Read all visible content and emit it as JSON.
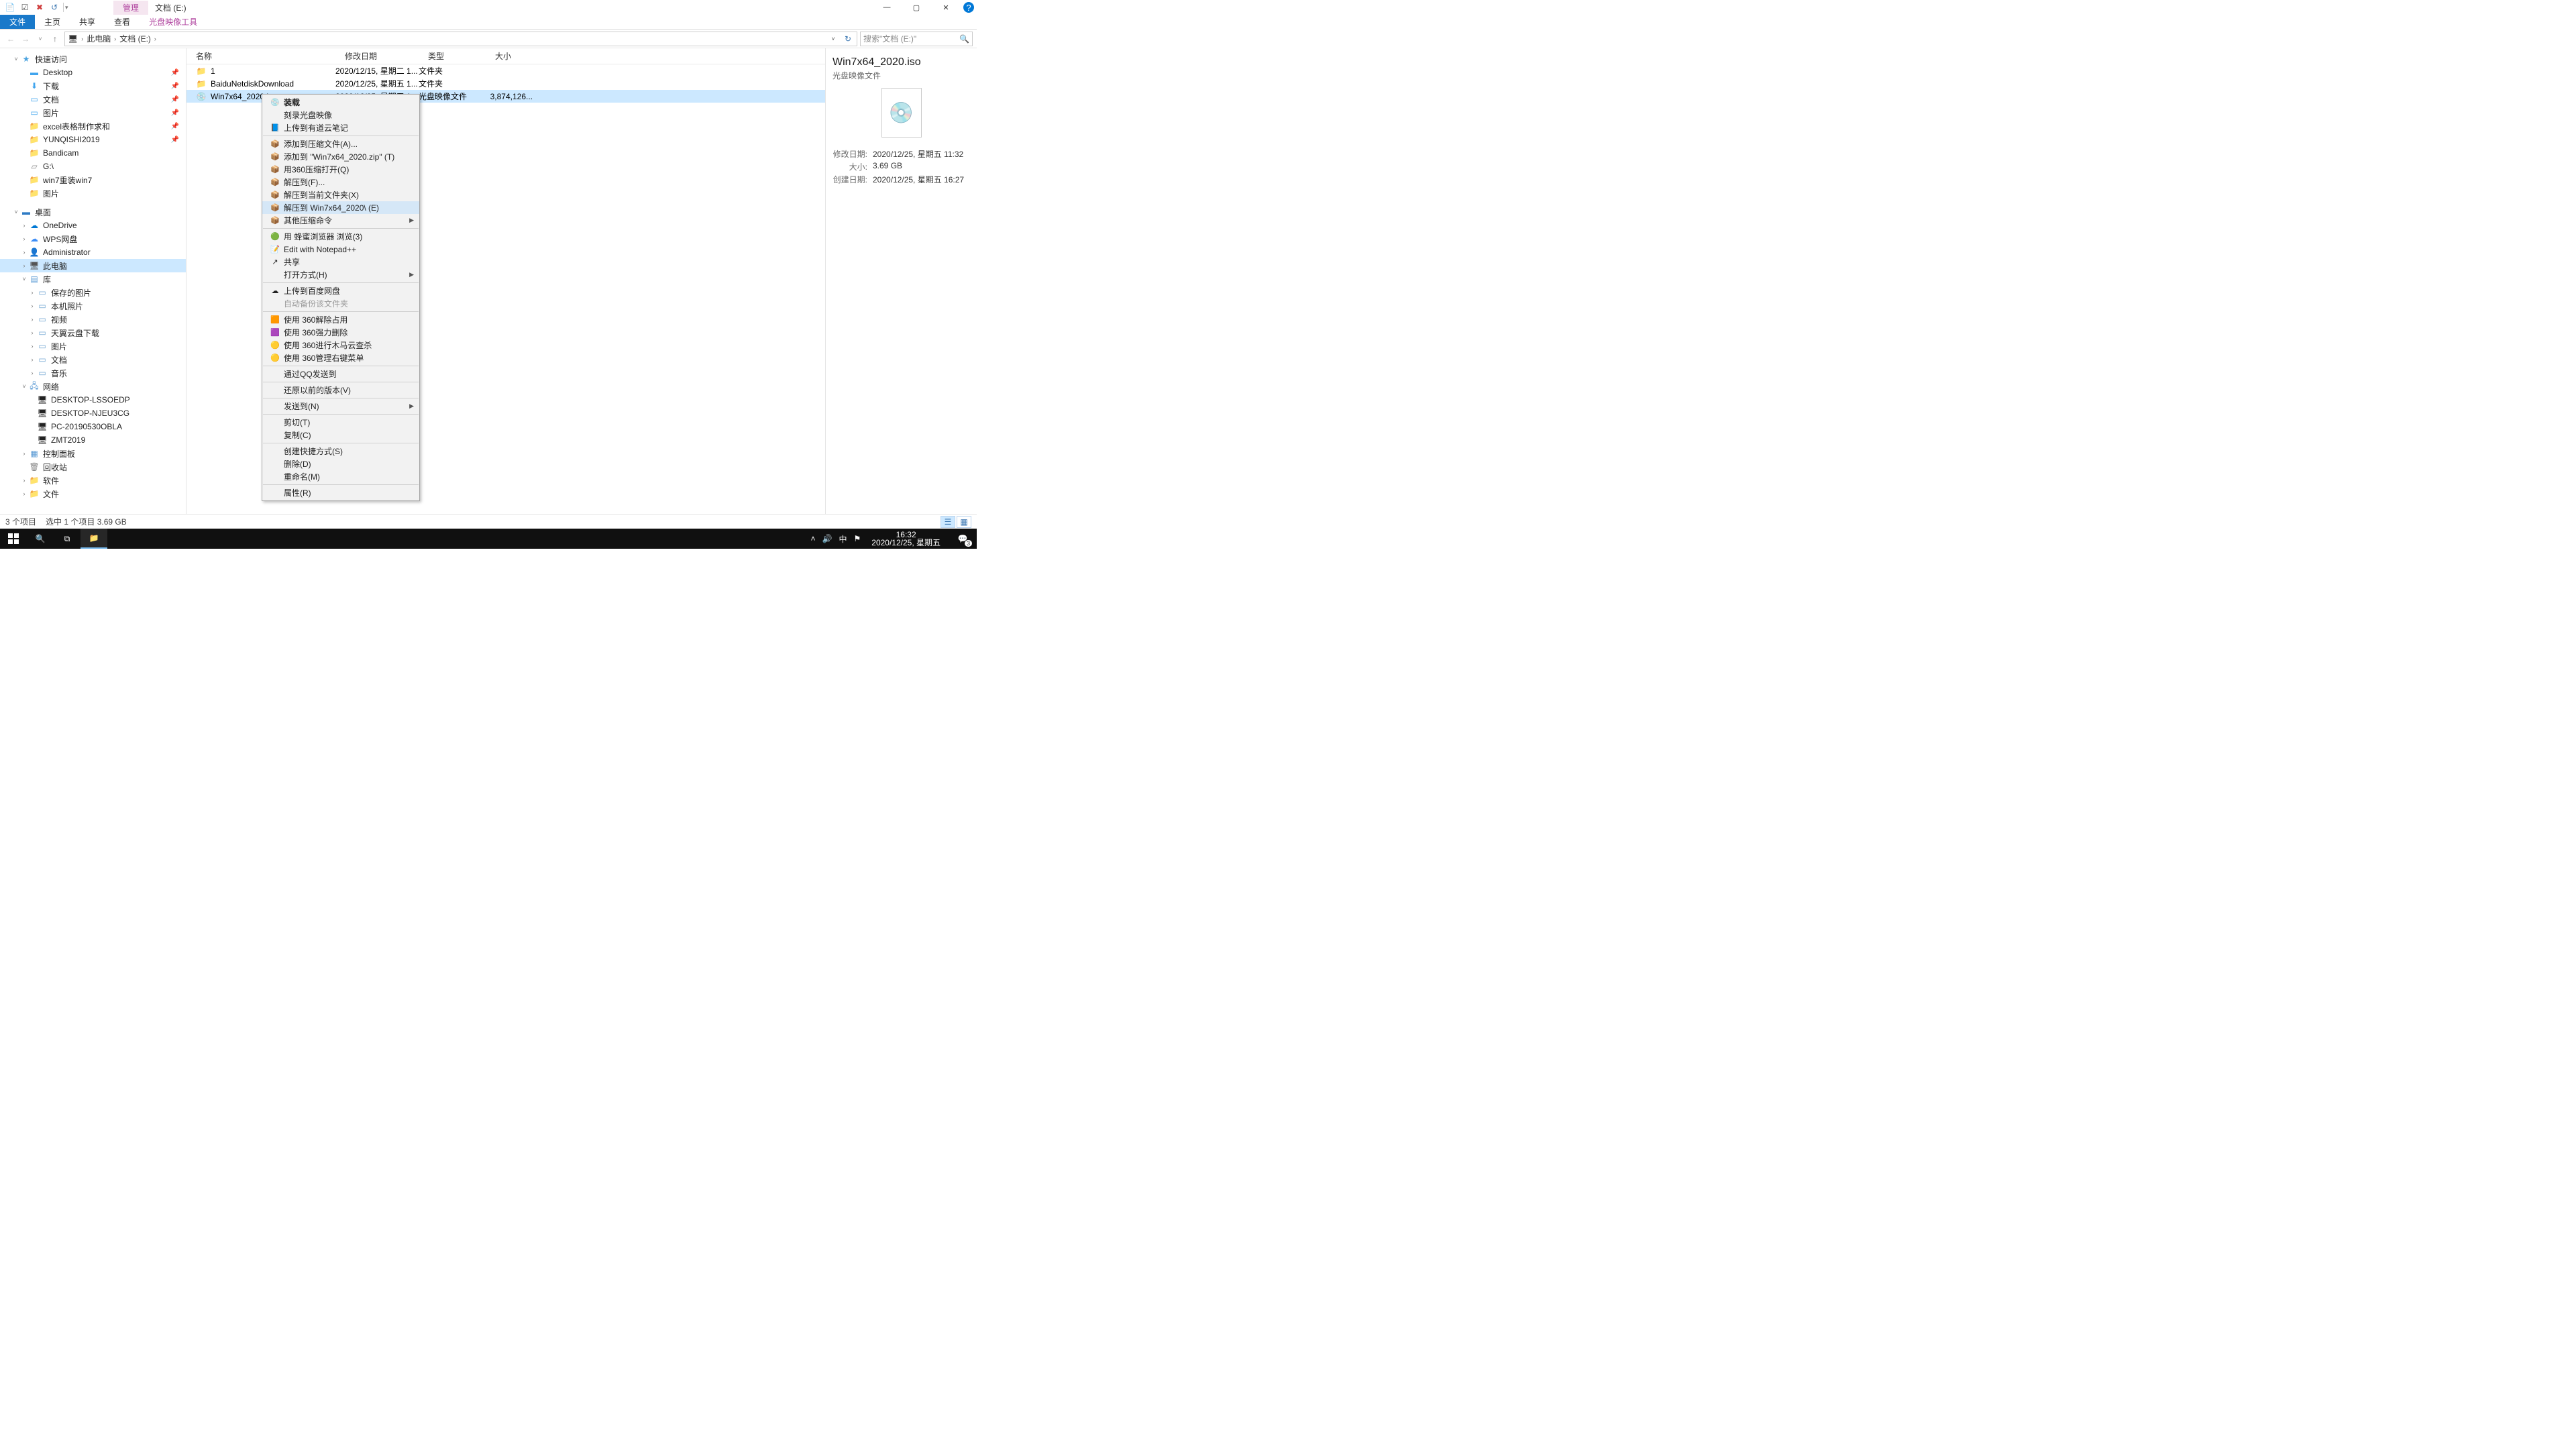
{
  "window": {
    "mgmtTab": "管理",
    "title": "文档 (E:)",
    "min": "—",
    "max": "▢",
    "close": "✕",
    "help": "?"
  },
  "ribbon": {
    "file": "文件",
    "home": "主页",
    "share": "共享",
    "view": "查看",
    "ctx": "光盘映像工具"
  },
  "nav": {
    "back": "←",
    "fwd": "→",
    "up": "↑",
    "path": {
      "root": "此电脑",
      "crumb": "文档 (E:)"
    },
    "searchPlaceholder": "搜索\"文档 (E:)\""
  },
  "tree": {
    "quick": "快速访问",
    "desktop": "Desktop",
    "downloads": "下载",
    "documents": "文档",
    "pictures": "图片",
    "excel": "excel表格制作求和",
    "yunqishi": "YUNQISHI2019",
    "bandicam": "Bandicam",
    "g": "G:\\",
    "win7re": "win7重装win7",
    "pics2": "图片",
    "desk": "桌面",
    "onedrive": "OneDrive",
    "wps": "WPS网盘",
    "admin": "Administrator",
    "thispc": "此电脑",
    "lib": "库",
    "savedpics": "保存的图片",
    "localpics": "本机照片",
    "video": "视频",
    "tianyi": "天翼云盘下载",
    "picsl": "图片",
    "docs": "文档",
    "music": "音乐",
    "network": "网络",
    "pc1": "DESKTOP-LSSOEDP",
    "pc2": "DESKTOP-NJEU3CG",
    "pc3": "PC-20190530OBLA",
    "pc4": "ZMT2019",
    "ctrl": "控制面板",
    "recycle": "回收站",
    "soft": "软件",
    "files": "文件"
  },
  "cols": {
    "name": "名称",
    "date": "修改日期",
    "type": "类型",
    "size": "大小"
  },
  "rows": [
    {
      "name": "1",
      "date": "2020/12/15, 星期二 1...",
      "type": "文件夹",
      "size": "",
      "icon": "folder"
    },
    {
      "name": "BaiduNetdiskDownload",
      "date": "2020/12/25, 星期五 1...",
      "type": "文件夹",
      "size": "",
      "icon": "folder"
    },
    {
      "name": "Win7x64_2020.iso",
      "date": "2020/12/25, 星期五 1...",
      "type": "光盘映像文件",
      "size": "3,874,126...",
      "icon": "iso",
      "selected": true
    }
  ],
  "context": [
    {
      "label": "装载",
      "icon": "💿",
      "bold": true
    },
    {
      "label": "刻录光盘映像",
      "icon": ""
    },
    {
      "label": "上传到有道云笔记",
      "icon": "📘"
    },
    {
      "sep": true
    },
    {
      "label": "添加到压缩文件(A)...",
      "icon": "📦"
    },
    {
      "label": "添加到 \"Win7x64_2020.zip\" (T)",
      "icon": "📦"
    },
    {
      "label": "用360压缩打开(Q)",
      "icon": "📦"
    },
    {
      "label": "解压到(F)...",
      "icon": "📦"
    },
    {
      "label": "解压到当前文件夹(X)",
      "icon": "📦"
    },
    {
      "label": "解压到 Win7x64_2020\\ (E)",
      "icon": "📦",
      "hover": true
    },
    {
      "label": "其他压缩命令",
      "icon": "📦",
      "sub": true
    },
    {
      "sep": true
    },
    {
      "label": "用 蜂蜜浏览器 浏览(3)",
      "icon": "🟢"
    },
    {
      "label": "Edit with Notepad++",
      "icon": "📝"
    },
    {
      "label": "共享",
      "icon": "↗"
    },
    {
      "label": "打开方式(H)",
      "icon": "",
      "sub": true
    },
    {
      "sep": true
    },
    {
      "label": "上传到百度网盘",
      "icon": "☁"
    },
    {
      "label": "自动备份该文件夹",
      "icon": "",
      "disabled": true
    },
    {
      "sep": true
    },
    {
      "label": "使用 360解除占用",
      "icon": "🟧"
    },
    {
      "label": "使用 360强力删除",
      "icon": "🟪"
    },
    {
      "label": "使用 360进行木马云查杀",
      "icon": "🟡"
    },
    {
      "label": "使用 360管理右键菜单",
      "icon": "🟡"
    },
    {
      "sep": true
    },
    {
      "label": "通过QQ发送到",
      "icon": ""
    },
    {
      "sep": true
    },
    {
      "label": "还原以前的版本(V)",
      "icon": ""
    },
    {
      "sep": true
    },
    {
      "label": "发送到(N)",
      "icon": "",
      "sub": true
    },
    {
      "sep": true
    },
    {
      "label": "剪切(T)",
      "icon": ""
    },
    {
      "label": "复制(C)",
      "icon": ""
    },
    {
      "sep": true
    },
    {
      "label": "创建快捷方式(S)",
      "icon": ""
    },
    {
      "label": "删除(D)",
      "icon": ""
    },
    {
      "label": "重命名(M)",
      "icon": ""
    },
    {
      "sep": true
    },
    {
      "label": "属性(R)",
      "icon": ""
    }
  ],
  "details": {
    "title": "Win7x64_2020.iso",
    "subtitle": "光盘映像文件",
    "props": [
      {
        "k": "修改日期:",
        "v": "2020/12/25, 星期五 11:32"
      },
      {
        "k": "大小:",
        "v": "3.69 GB"
      },
      {
        "k": "创建日期:",
        "v": "2020/12/25, 星期五 16:27"
      }
    ]
  },
  "status": {
    "items": "3 个项目",
    "sel": "选中 1 个项目  3.69 GB"
  },
  "taskbar": {
    "ime": "中",
    "time": "16:32",
    "date": "2020/12/25, 星期五",
    "badge": "3"
  }
}
